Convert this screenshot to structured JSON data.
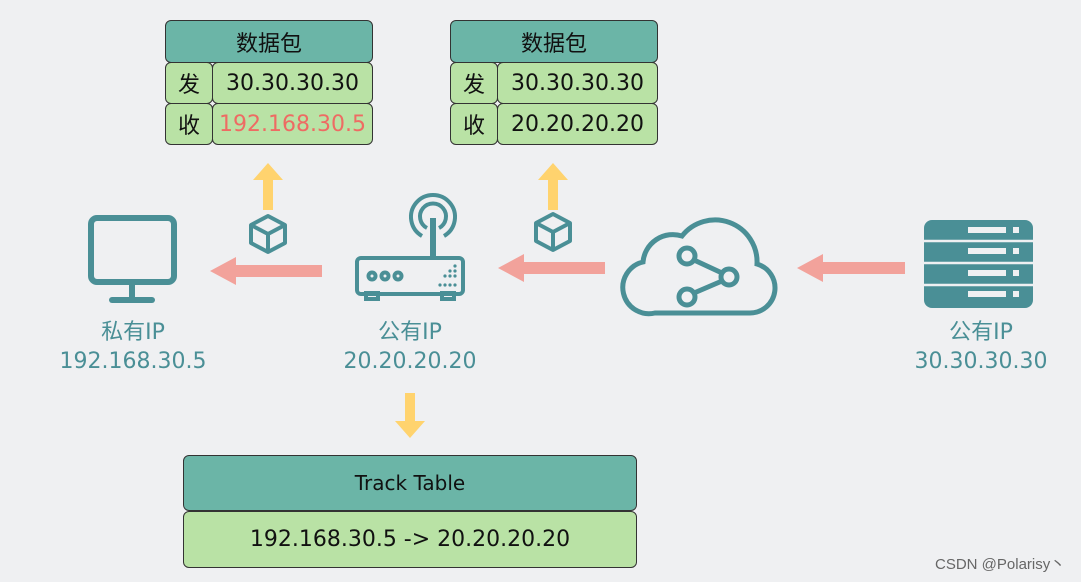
{
  "packets": [
    {
      "title": "数据包",
      "src_label": "发",
      "src": "30.30.30.30",
      "dst_label": "收",
      "dst": "192.168.30.5",
      "dst_color": "#ee6b63"
    },
    {
      "title": "数据包",
      "src_label": "发",
      "src": "30.30.30.30",
      "dst_label": "收",
      "dst": "20.20.20.20",
      "dst_color": "#111111"
    }
  ],
  "nodes": {
    "pc": {
      "type": "私有IP",
      "ip": "192.168.30.5"
    },
    "router": {
      "type": "公有IP",
      "ip": "20.20.20.20"
    },
    "server": {
      "type": "公有IP",
      "ip": "30.30.30.30"
    }
  },
  "track_table": {
    "title": "Track Table",
    "entry": "192.168.30.5 -> 20.20.20.20"
  },
  "watermark": "CSDN @Polarisy丶",
  "colors": {
    "icon": "#4a8f96",
    "arrow_flow": "#f2a29b",
    "arrow_up": "#ffd36e",
    "header": "#6bb5a7",
    "cell": "#b9e2a5"
  }
}
